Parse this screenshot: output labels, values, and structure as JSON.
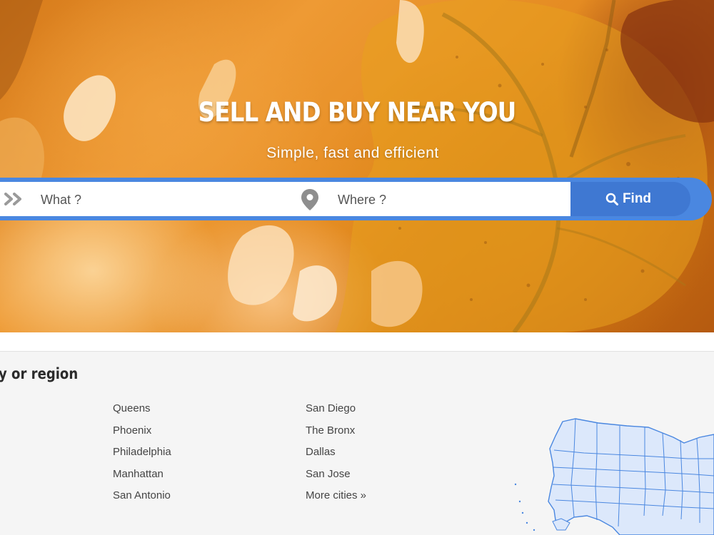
{
  "hero": {
    "title": "SELL AND BUY NEAR YOU",
    "subtitle": "Simple, fast and efficient"
  },
  "search": {
    "what_placeholder": "What ?",
    "where_placeholder": "Where ?",
    "find_label": "Find"
  },
  "cities": {
    "section_title": "y or region",
    "column_1": [
      "Queens",
      "Phoenix",
      "Philadelphia",
      "Manhattan",
      "San Antonio"
    ],
    "column_2": [
      "San Diego",
      "The Bronx",
      "Dallas",
      "San Jose",
      "More cities »"
    ]
  },
  "colors": {
    "accent_blue": "#4a87e0",
    "find_button": "#3f78d2",
    "map_fill": "#dce8fb",
    "map_stroke": "#4a87e0"
  },
  "icons": {
    "what": "double-chevron-right-icon",
    "where": "map-pin-icon",
    "find": "search-icon"
  }
}
